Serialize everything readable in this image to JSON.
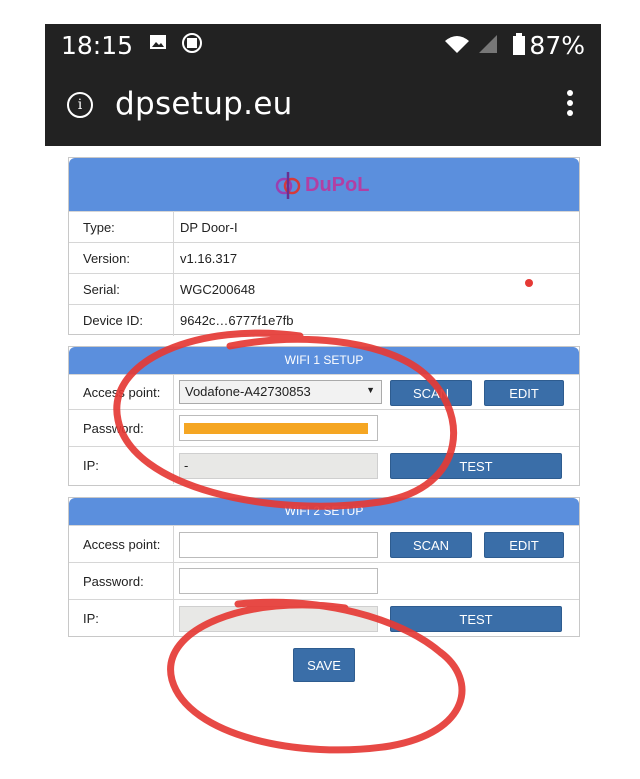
{
  "status_bar": {
    "time": "18:15",
    "battery": "87%",
    "icons": [
      "image-icon",
      "sim-icon",
      "wifi-icon",
      "signal-icon",
      "battery-icon"
    ]
  },
  "browser": {
    "url": "dpsetup.eu",
    "info_glyph": "i"
  },
  "logo": {
    "text": "DuPoL",
    "glyph": "dp"
  },
  "device_info": {
    "rows": [
      {
        "label": "Type:",
        "value": "DP Door-I"
      },
      {
        "label": "Version:",
        "value": "v1.16.317"
      },
      {
        "label": "Serial:",
        "value": "WGC200648"
      },
      {
        "label": "Device ID:",
        "value": "9642c…6777f1e7fb"
      }
    ]
  },
  "wifi1": {
    "title": "WIFI 1 SETUP",
    "access_point_label": "Access point:",
    "access_point_value": "Vodafone-A42730853",
    "scan_label": "SCAN",
    "edit_label": "EDIT",
    "password_label": "Password:",
    "ip_label": "IP:",
    "ip_value": "-",
    "test_label": "TEST"
  },
  "wifi2": {
    "title": "WIFI 2 SETUP",
    "access_point_label": "Access point:",
    "scan_label": "SCAN",
    "edit_label": "EDIT",
    "password_label": "Password:",
    "ip_label": "IP:",
    "test_label": "TEST"
  },
  "save_label": "SAVE",
  "colors": {
    "header_blue": "#5b8fdd",
    "button_blue": "#3a6ea8",
    "redaction": "#f5a623",
    "annotation_red": "#e53935"
  }
}
